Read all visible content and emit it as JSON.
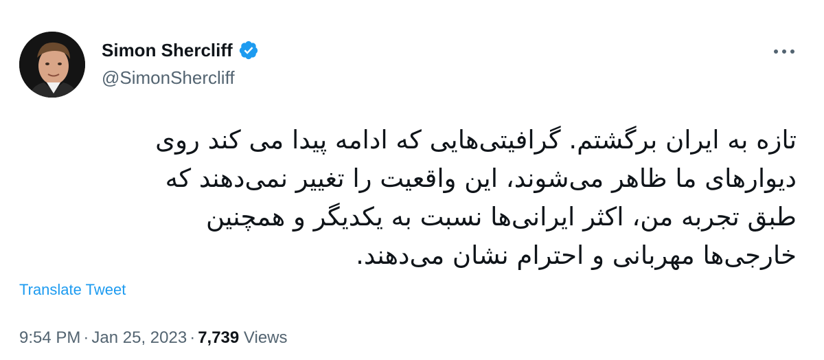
{
  "author": {
    "display_name": "Simon Shercliff",
    "handle": "@SimonShercliff",
    "verified": true,
    "verified_color": "#1d9bf0"
  },
  "tweet": {
    "lines": [
      "تازه به ایران برگشتم. گرافیتی‌هایی که ادامه پیدا می کند روی",
      "دیوارهای ما ظاهر می‌شوند، این واقعیت را تغییر نمی‌دهند که",
      "طبق تجربه من، اکثر ایرانی‌ها نسبت به یکدیگر و همچنین",
      "خارجی‌ها مهربانی و احترام نشان می‌دهند."
    ]
  },
  "translate_label": "Translate Tweet",
  "meta": {
    "time": "9:54 PM",
    "separator": "·",
    "date": "Jan 25, 2023",
    "views_count": "7,739",
    "views_label": "Views"
  },
  "icons": {
    "more": "more-horizontal-icon",
    "verified": "verified-badge-icon"
  },
  "colors": {
    "text": "#0f1419",
    "secondary": "#536471",
    "link": "#1d9bf0"
  }
}
